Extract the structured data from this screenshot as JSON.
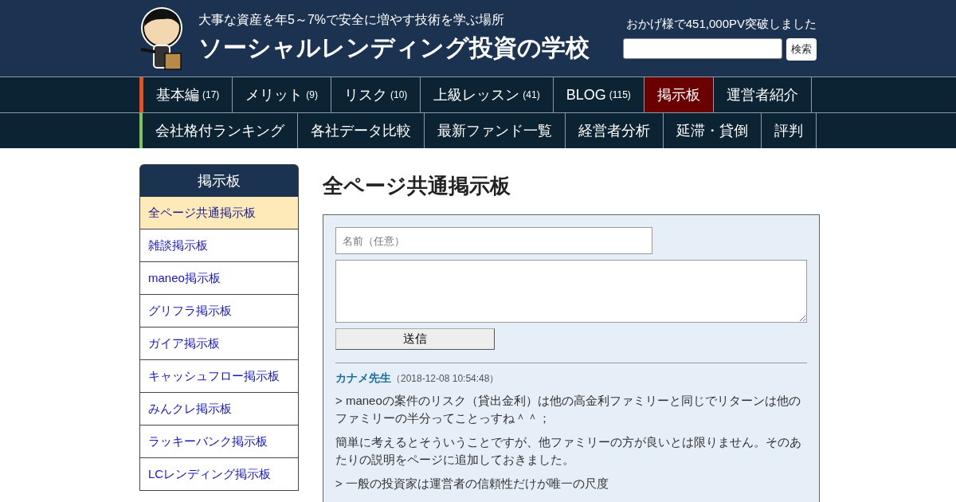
{
  "header": {
    "tagline": "大事な資産を年5～7%で安全に増やす技術を学ぶ場所",
    "site_title": "ソーシャルレンディング投資の学校",
    "pv_notice": "おかげ様で451,000PV突破しました",
    "search": {
      "button": "検索"
    }
  },
  "nav_rows": [
    {
      "color": "#e8501e",
      "items": [
        {
          "label": "基本編",
          "count": "(17)",
          "selected": false
        },
        {
          "label": "メリット",
          "count": "(9)",
          "selected": false
        },
        {
          "label": "リスク",
          "count": "(10)",
          "selected": false
        },
        {
          "label": "上級レッスン",
          "count": "(41)",
          "selected": false
        },
        {
          "label": "BLOG",
          "count": "(115)",
          "selected": false
        },
        {
          "label": "掲示板",
          "selected": true
        },
        {
          "label": "運営者紹介",
          "selected": false
        }
      ]
    },
    {
      "color": "#7cc35a",
      "items": [
        {
          "label": "会社格付ランキング",
          "selected": false
        },
        {
          "label": "各社データ比較",
          "selected": false
        },
        {
          "label": "最新ファンド一覧",
          "selected": false
        },
        {
          "label": "経営者分析",
          "selected": false
        },
        {
          "label": "延滞・貸倒",
          "selected": false
        },
        {
          "label": "評判",
          "selected": false
        }
      ]
    }
  ],
  "sidebar": {
    "title": "掲示板",
    "items": [
      {
        "label": "全ページ共通掲示板",
        "selected": true
      },
      {
        "label": "雑談掲示板",
        "selected": false
      },
      {
        "label": "maneo掲示板",
        "selected": false
      },
      {
        "label": "グリフラ掲示板",
        "selected": false
      },
      {
        "label": "ガイア掲示板",
        "selected": false
      },
      {
        "label": "キャッシュフロー掲示板",
        "selected": false
      },
      {
        "label": "みんクレ掲示板",
        "selected": false
      },
      {
        "label": "ラッキーバンク掲示板",
        "selected": false
      },
      {
        "label": "LCレンディング掲示板",
        "selected": false
      }
    ]
  },
  "main": {
    "title": "全ページ共通掲示板",
    "form": {
      "name_placeholder": "名前（任意）",
      "submit": "送信"
    },
    "posts": [
      {
        "author": "カナメ先生",
        "time": "（2018-12-08 10:54:48）",
        "paragraphs": [
          "> maneoの案件のリスク（貸出金利）は他の高金利ファミリーと同じでリターンは他のファミリーの半分ってことっすね＾＾；",
          "簡単に考えるとそういうことですが、他ファミリーの方が良いとは限りません。そのあたりの説明をページに追加しておきました。",
          "> 一般の投資家は運営者の信頼性だけが唯一の尺度"
        ]
      }
    ]
  }
}
